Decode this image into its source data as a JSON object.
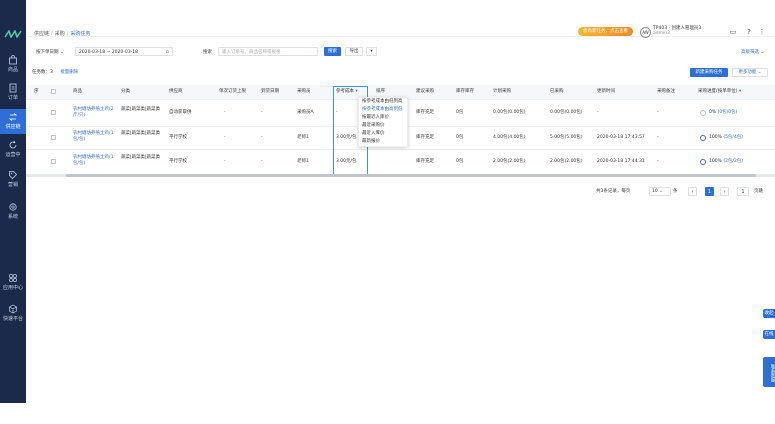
{
  "breadcrumb": {
    "root": "供应链",
    "parent": "采购",
    "current": "采购任务"
  },
  "header": {
    "notice": "您有新任务，点击查看",
    "user_line1": "TP403 · 创建人管理员3",
    "user_line2": "admin3",
    "avatar": "AW"
  },
  "sidebar": {
    "items": [
      {
        "label": "商品"
      },
      {
        "label": "订单"
      },
      {
        "label": "供应链"
      },
      {
        "label": "运营中"
      },
      {
        "label": "营销"
      },
      {
        "label": "系统"
      },
      {
        "label": "应用中心"
      },
      {
        "label": "快速平台"
      }
    ]
  },
  "filters": {
    "date_type": "按下单日期",
    "date_range": "2020-03-18 ~ 2020-03-18",
    "search_label": "搜索",
    "search_placeholder": "输入订单号、商品名称或规格",
    "search_button": "搜索",
    "export_button": "导出",
    "advanced": "高级筛选"
  },
  "summary": {
    "label": "任务数：3",
    "link": "批量删除"
  },
  "actions": {
    "primary": "新建采购任务",
    "more": "更多功能"
  },
  "table": {
    "columns": [
      "序",
      "商品",
      "分类",
      "供应商",
      "单次订货上限",
      "到货日期",
      "采购员",
      "参考成本",
      "排序",
      "建议采购",
      "库存库存",
      "计划采购",
      "已采购",
      "更新时间",
      "采购备注",
      "采购进度(按单单位)"
    ],
    "rows": [
      {
        "product": "农村塘坊养殖土鸡(2斤/只)",
        "category": "蔬菜|蔬菜类|蔬菜类",
        "supplier": "自动获取供",
        "limit": "-",
        "date": "-",
        "buyer": "采购员A",
        "cost": "-",
        "order": "-",
        "suggest": "库存充足",
        "stock": "0包",
        "plan": "0.00包(0.00包)",
        "bought": "0.00包(0.00包)",
        "updated": "-",
        "note": "-",
        "progress": "0%",
        "progress_link": "(0包/0包)",
        "pct": 0
      },
      {
        "product": "农村塘坊养殖土鸡(1包/包)",
        "category": "蔬菜|蔬菜类|蔬菜类",
        "supplier": "平行学校",
        "limit": "-",
        "date": "-",
        "buyer": "老师1",
        "cost": "3.00元/包",
        "order": "-",
        "suggest": "库存充足",
        "stock": "0包",
        "plan": "4.00包(4.00包)",
        "bought": "5.00包(5.00包)",
        "updated": "2020-03-18 17:43:57",
        "note": "-",
        "progress": "100%",
        "progress_link": "(5包/4包)",
        "pct": 100
      },
      {
        "product": "农村塘坊养殖土鸡(1包/包)",
        "category": "蔬菜|蔬菜类|蔬菜类",
        "supplier": "平行学校",
        "limit": "-",
        "date": "-",
        "buyer": "老师1",
        "cost": "3.00元/包",
        "order": "-",
        "suggest": "库存充足",
        "stock": "0包",
        "plan": "2.00包(2.00包)",
        "bought": "2.00包(2.00包)",
        "updated": "2020-03-18 17:44:31",
        "note": "-",
        "progress": "100%",
        "progress_link": "(2包/2包)",
        "pct": 100
      }
    ]
  },
  "sort_menu": {
    "items": [
      "按参考成本由低到高",
      "按参考成本由高到低",
      "按最近入库价",
      "最近采购价",
      "最近入库价",
      "最新报价"
    ],
    "selected_index": 1
  },
  "pager": {
    "total": "共3条记录，每页",
    "page_size": "10",
    "unit": "条",
    "current": "1",
    "jump": "1",
    "go": "页跳"
  },
  "side_tabs": [
    "收起",
    "在线",
    "联系客服"
  ],
  "colors": {
    "accent": "#2d6fd6",
    "sidebar": "#1b2a4a",
    "notice": "#f08a24"
  }
}
